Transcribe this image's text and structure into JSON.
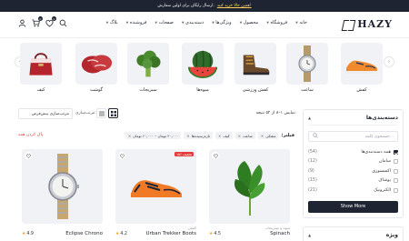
{
  "promo": {
    "text": "ارسال رایگان برای اولین سفارش.",
    "link": "همین حالا خرید کنید!"
  },
  "brand": {
    "name": "HAZY"
  },
  "nav": {
    "items": [
      {
        "label": "خانه",
        "has_menu": true
      },
      {
        "label": "فروشگاه",
        "has_menu": true
      },
      {
        "label": "محصول",
        "has_menu": true
      },
      {
        "label": "ویژگی‌ها",
        "has_menu": true
      },
      {
        "label": "دسته‌بندی",
        "has_menu": true
      },
      {
        "label": "صفحات",
        "has_menu": true
      },
      {
        "label": "فروشنده",
        "has_menu": true
      },
      {
        "label": "بلاگ",
        "has_menu": true
      }
    ]
  },
  "header_icons": {
    "cart_count": "0",
    "wishlist_count": "0"
  },
  "categories": [
    {
      "label": "کفش",
      "icon": "sneaker"
    },
    {
      "label": "ساعت",
      "icon": "watch"
    },
    {
      "label": "کفش ورزشی",
      "icon": "boot"
    },
    {
      "label": "میوه‌ها",
      "icon": "watermelon"
    },
    {
      "label": "سبزیجات",
      "icon": "broccoli"
    },
    {
      "label": "گوشت",
      "icon": "meat"
    },
    {
      "label": "کیف",
      "icon": "bag"
    }
  ],
  "sidebar": {
    "categories_title": "دسته‌بندی‌ها",
    "search_placeholder": "جستجوی کلمه...",
    "items": [
      {
        "label": "همه دسته‌بندی‌ها",
        "count": "(54)",
        "checked": true
      },
      {
        "label": "سامان",
        "count": "(12)",
        "checked": false
      },
      {
        "label": "اکسسوری",
        "count": "(9)",
        "checked": false
      },
      {
        "label": "پوشاک",
        "count": "(15)",
        "checked": false
      },
      {
        "label": "الکترونیک",
        "count": "(21)",
        "checked": false
      }
    ],
    "show_more": "Show More",
    "second_title": "ویژه"
  },
  "toolbar": {
    "showing": "نمایش ۱–۸ از ۵۲ نتیجه",
    "sort_label": "مرتب‌سازی:",
    "sort_value": "مرتب‌سازی پیش‌فرض"
  },
  "filters": {
    "title": "فیلتر:",
    "chips": [
      "مشکی",
      "ساعت",
      "کیف",
      "تازه‌رسیده‌ها",
      "۲۰,۰۰۰ تومان – ۶۰,۰۰۰ تومان"
    ],
    "clear_all": "پاک کردن همه"
  },
  "products": [
    {
      "name": "Spinach",
      "category": "میوه و سبزیجات",
      "rating": "4.5",
      "sale": "",
      "image": "spinach"
    },
    {
      "name": "Urban Trekker Boots",
      "category": "کفش",
      "rating": "4.2",
      "sale": "۱۵٪ تخفیف",
      "image": "shoe"
    },
    {
      "name": "Eclipse Chrono",
      "category": "",
      "rating": "4.9",
      "sale": "",
      "image": "watch"
    }
  ],
  "colors": {
    "dark": "#1e2431",
    "accent_red": "#e23c3c",
    "promo_link": "#ffd266",
    "card_bg": "#f1f2f5"
  }
}
